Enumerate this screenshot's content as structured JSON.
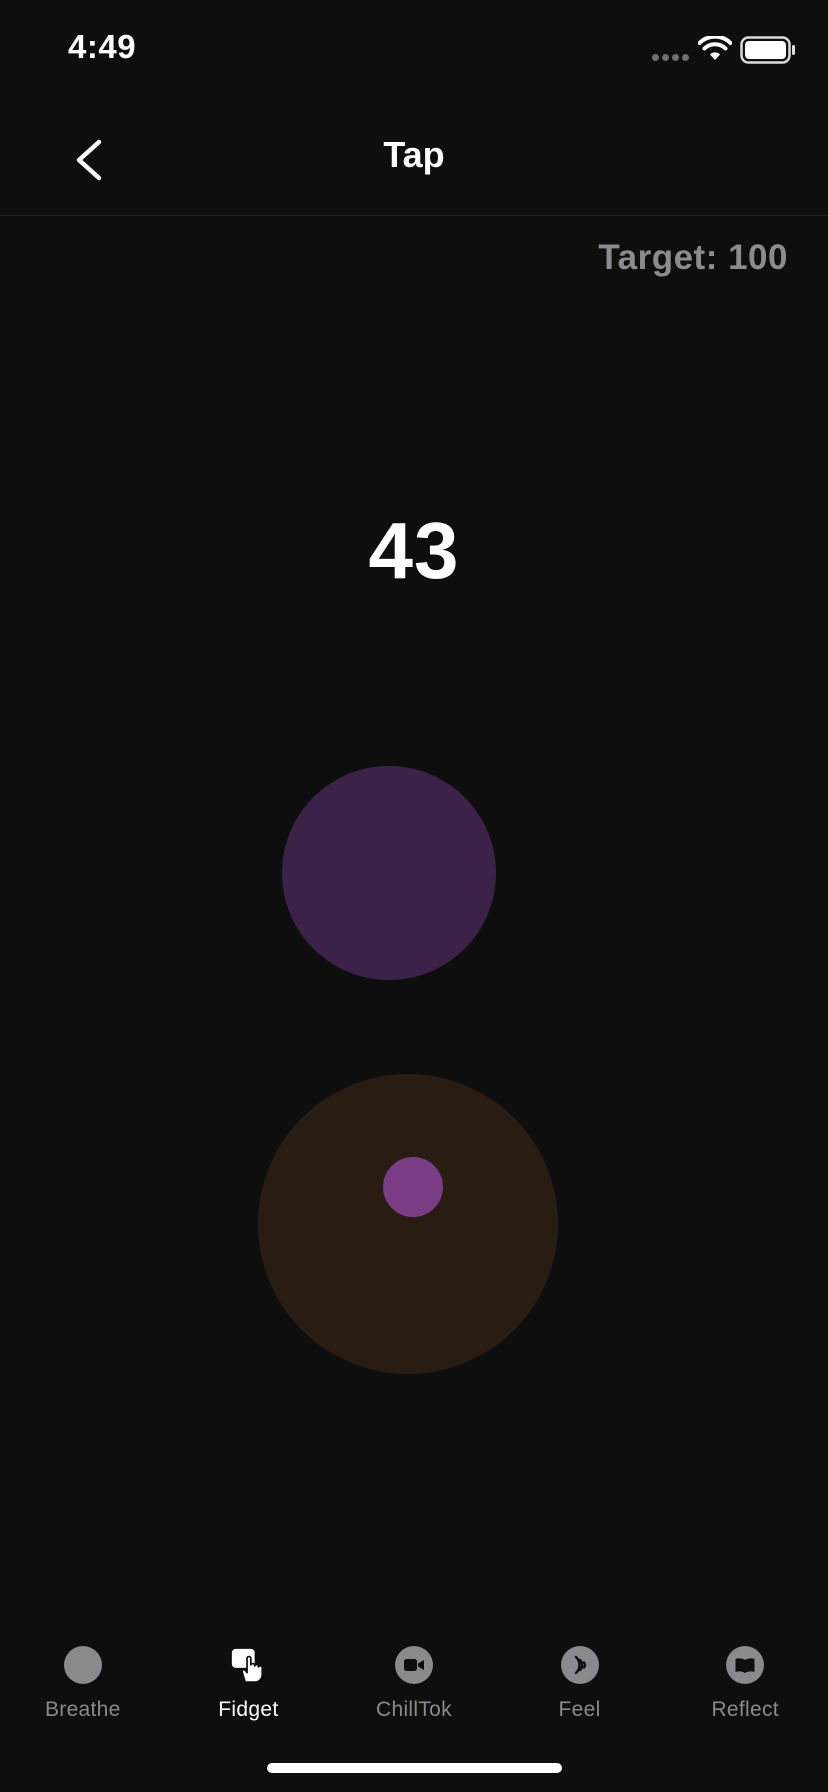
{
  "status_bar": {
    "time": "4:49"
  },
  "nav": {
    "title": "Tap",
    "back_icon": "chevron-left-icon"
  },
  "target": {
    "text": "Target: 100"
  },
  "counter": {
    "value": "43"
  },
  "colors": {
    "background": "#0e0e0f",
    "purple_circle": "#3c2248",
    "brown_circle": "#291d13",
    "dot": "#7a3c85",
    "inactive": "#8a8a8e"
  },
  "tabs": [
    {
      "label": "Breathe",
      "icon": "circle-icon",
      "active": false
    },
    {
      "label": "Fidget",
      "icon": "hand-tap-icon",
      "active": true
    },
    {
      "label": "ChillTok",
      "icon": "video-camera-icon",
      "active": false
    },
    {
      "label": "Feel",
      "icon": "vibration-icon",
      "active": false
    },
    {
      "label": "Reflect",
      "icon": "book-icon",
      "active": false
    }
  ]
}
